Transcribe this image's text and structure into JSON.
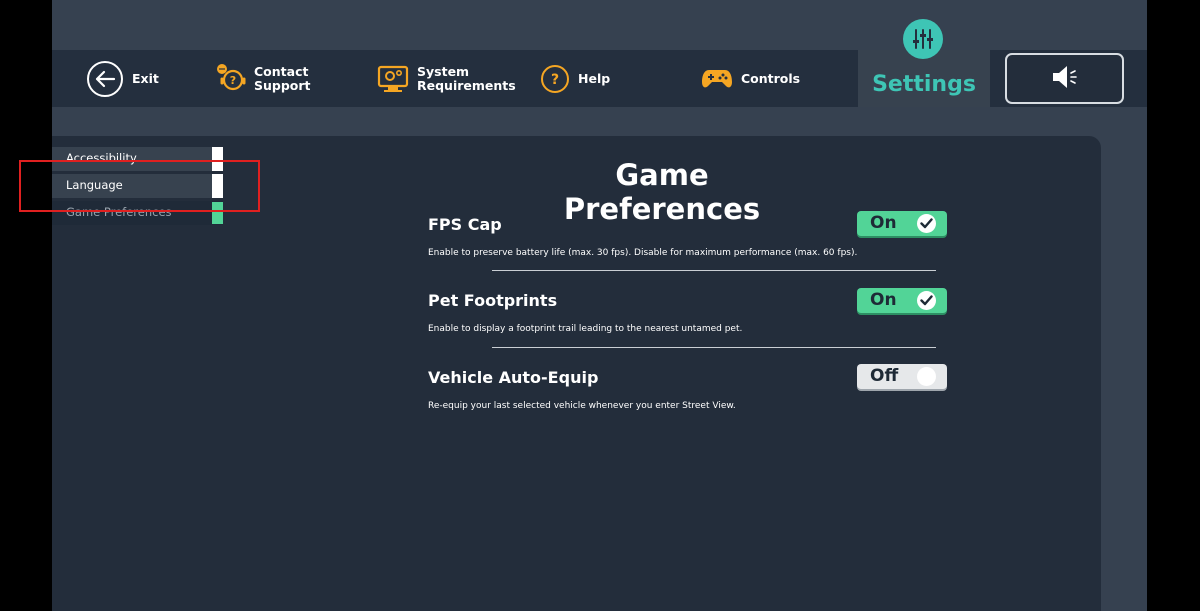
{
  "nav": {
    "exit": "Exit",
    "contact": [
      "Contact",
      "Support"
    ],
    "system": [
      "System",
      "Requirements"
    ],
    "help": "Help",
    "controls": "Controls",
    "settings": "Settings"
  },
  "sidebar": {
    "items": [
      {
        "label": "Accessibility",
        "active": false
      },
      {
        "label": "Language",
        "active": false
      },
      {
        "label": "Game Preferences",
        "active": true
      }
    ]
  },
  "main": {
    "title": "Game Preferences",
    "prefs": [
      {
        "name": "FPS Cap",
        "desc": "Enable to preserve battery life (max. 30 fps). Disable for maximum performance (max. 60 fps).",
        "state": "On"
      },
      {
        "name": "Pet Footprints",
        "desc": "Enable to display a footprint trail leading to the nearest untamed pet.",
        "state": "On"
      },
      {
        "name": "Vehicle Auto-Equip",
        "desc": "Re-equip your last selected vehicle whenever you enter Street View.",
        "state": "Off"
      }
    ]
  },
  "icons": {
    "exit": "back-arrow-icon",
    "contact": "support-headset-icon",
    "system": "monitor-gear-icon",
    "help": "question-icon",
    "controls": "gamepad-icon",
    "settings": "sliders-icon",
    "sound": "speaker-icon",
    "check": "check-icon"
  },
  "colors": {
    "accent": "#3ec5b5",
    "toggle_on": "#52d497",
    "nav_icon": "#f5a623",
    "highlight_box": "#e02020"
  }
}
